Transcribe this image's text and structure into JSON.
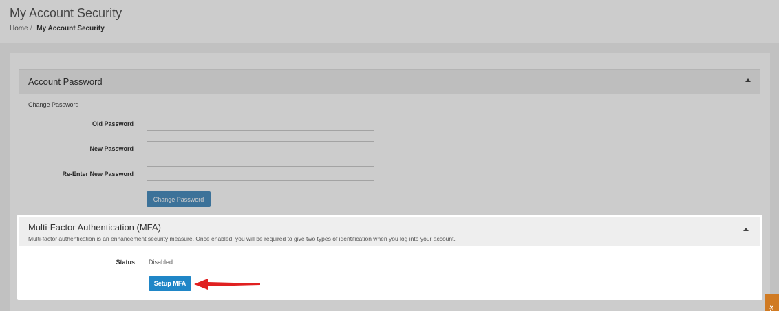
{
  "header": {
    "title": "My Account Security",
    "breadcrumb": {
      "home": "Home",
      "separator": "/",
      "current": "My Account Security"
    }
  },
  "password_panel": {
    "title": "Account Password",
    "section_label": "Change Password",
    "fields": [
      {
        "label": "Old Password",
        "value": ""
      },
      {
        "label": "New Password",
        "value": ""
      },
      {
        "label": "Re-Enter New Password",
        "value": ""
      }
    ],
    "button": "Change Password"
  },
  "mfa_panel": {
    "title": "Multi-Factor Authentication (MFA)",
    "description": "Multi-factor authentication is an enhancement security measure. Once enabled, you will be required to give two types of identification when you log into your account.",
    "status_label": "Status",
    "status_value": "Disabled",
    "button": "Setup MFA"
  },
  "feedback_tab": {
    "label": "ck"
  },
  "colors": {
    "primary_button": "#1f86c7",
    "arrow": "#e02020",
    "feedback_tab": "#d07a22"
  }
}
